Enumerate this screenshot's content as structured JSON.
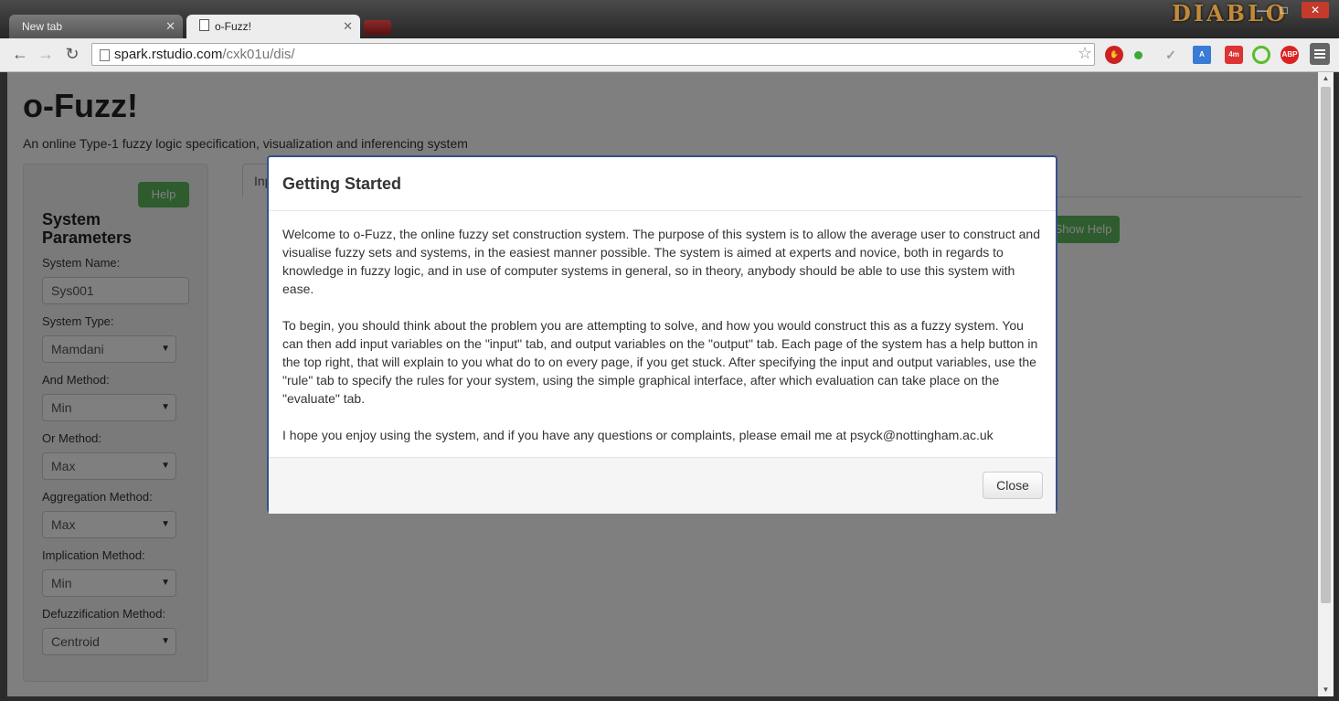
{
  "browser": {
    "tabs": [
      {
        "label": "New tab"
      },
      {
        "label": "o-Fuzz!"
      }
    ],
    "url_host": "spark.rstudio.com",
    "url_path": "/cxk01u/dis/",
    "brand_text": "DIABLO",
    "extensions": {
      "timer_badge": "4m",
      "abp": "ABP"
    }
  },
  "app": {
    "title": "o-Fuzz!",
    "subtitle": "An online Type-1 fuzzy logic specification, visualization and inferencing system",
    "help_label": "Help",
    "show_help_label": "Show Help",
    "tab_label": "Inp",
    "params_title": "System Parameters",
    "fields": {
      "name_label": "System Name:",
      "name_value": "Sys001",
      "type_label": "System Type:",
      "type_value": "Mamdani",
      "and_label": "And Method:",
      "and_value": "Min",
      "or_label": "Or Method:",
      "or_value": "Max",
      "agg_label": "Aggregation Method:",
      "agg_value": "Max",
      "impl_label": "Implication Method:",
      "impl_value": "Min",
      "defuzz_label": "Defuzzification Method:",
      "defuzz_value": "Centroid"
    }
  },
  "modal": {
    "title": "Getting Started",
    "paragraphs": [
      "Welcome to o-Fuzz, the online fuzzy set construction system. The purpose of this system is to allow the average user to construct and visualise fuzzy sets and systems, in the easiest manner possible. The system is aimed at experts and novice, both in regards to knowledge in fuzzy logic, and in use of computer systems in general, so in theory, anybody should be able to use this system with ease.",
      "To begin, you should think about the problem you are attempting to solve, and how you would construct this as a fuzzy system. You can then add input variables on the \"input\" tab, and output variables on the \"output\" tab. Each page of the system has a help button in the top right, that will explain to you what do to on every page, if you get stuck. After specifying the input and output variables, use the \"rule\" tab to specify the rules for your system, using the simple graphical interface, after which evaluation can take place on the \"evaluate\" tab.",
      "I hope you enjoy using the system, and if you have any questions or complaints, please email me at psyck@nottingham.ac.uk"
    ],
    "close_label": "Close"
  }
}
